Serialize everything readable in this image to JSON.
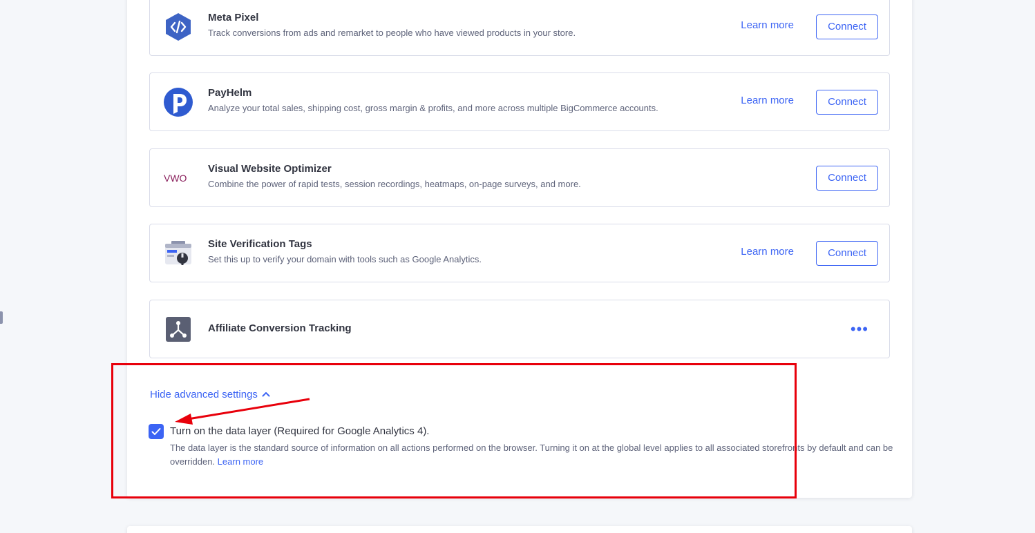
{
  "integrations": [
    {
      "logo": "code-hexagon-icon",
      "title": "Meta Pixel",
      "description": "Track conversions from ads and remarket to people who have viewed products in your store.",
      "learn_more": "Learn more",
      "action": "Connect"
    },
    {
      "logo": "payhelm-p-icon",
      "title": "PayHelm",
      "description": "Analyze your total sales, shipping cost, gross margin & profits, and more across multiple BigCommerce accounts.",
      "learn_more": "Learn more",
      "action": "Connect"
    },
    {
      "logo": "vwo-logo",
      "logo_text": "VWO",
      "title": "Visual Website Optimizer",
      "description": "Combine the power of rapid tests, session recordings, heatmaps, on-page surveys, and more.",
      "action": "Connect"
    },
    {
      "logo": "site-verification-icon",
      "title": "Site Verification Tags",
      "description": "Set this up to verify your domain with tools such as Google Analytics.",
      "learn_more": "Learn more",
      "action": "Connect"
    },
    {
      "logo": "affiliate-network-icon",
      "title": "Affiliate Conversion Tracking",
      "more_menu": "•••"
    }
  ],
  "advanced": {
    "toggle_label": "Hide advanced settings",
    "checkbox_checked": true,
    "checkbox_label": "Turn on the data layer (Required for Google Analytics 4).",
    "help_text": "The data layer is the standard source of information on all actions performed on the browser. Turning it on at the global level applies to all associated storefronts by default and can be overridden.",
    "help_link": "Learn more"
  },
  "colors": {
    "accent": "#3c64f4",
    "annotation": "#e8000b"
  }
}
